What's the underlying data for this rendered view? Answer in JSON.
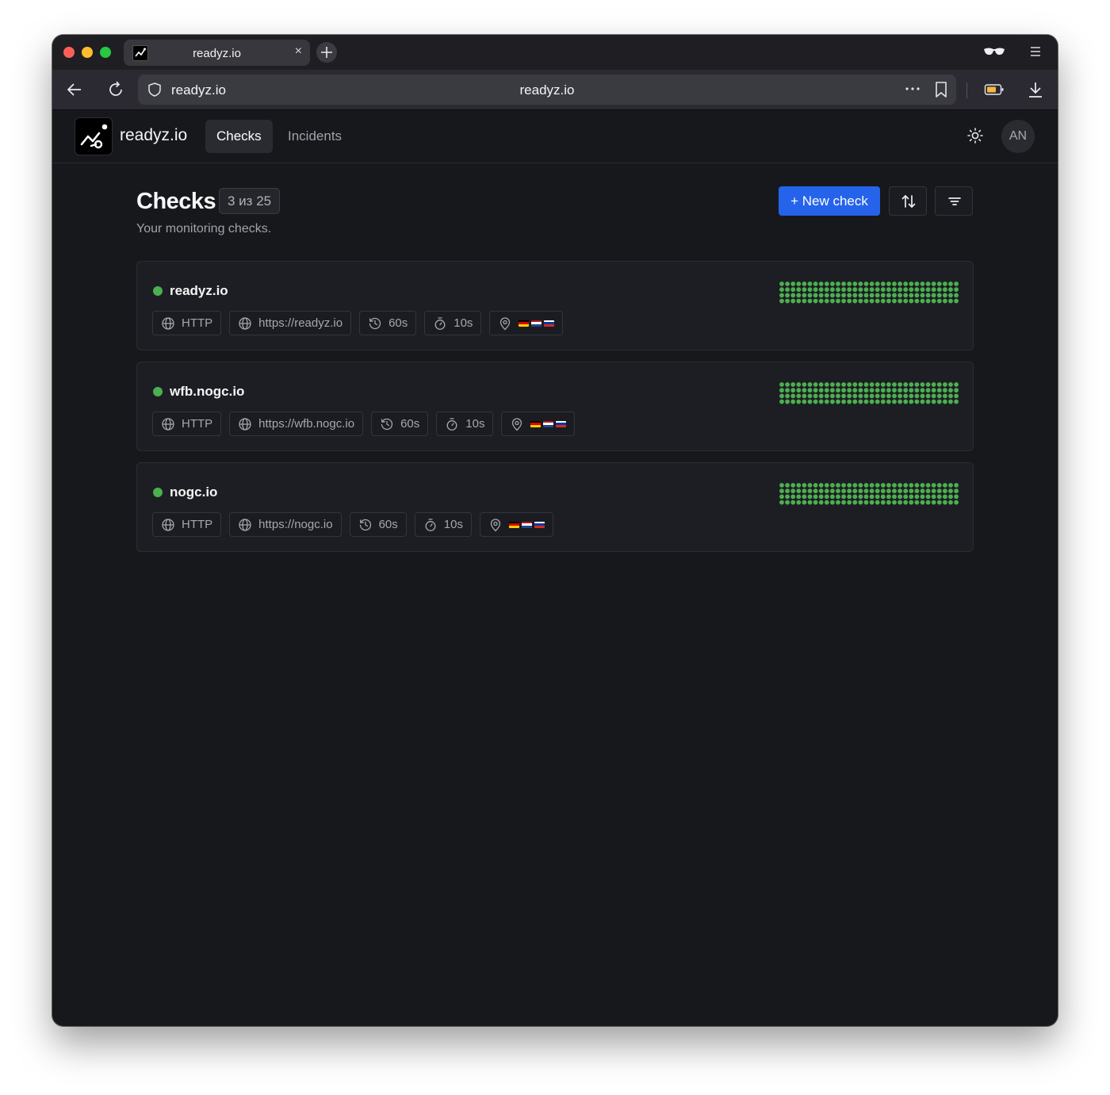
{
  "browser": {
    "tab_title": "readyz.io",
    "tab_close": "×",
    "url_host": "readyz.io",
    "url_center": "readyz.io"
  },
  "app": {
    "brand": "readyz.io",
    "nav": [
      {
        "label": "Checks",
        "active": true
      },
      {
        "label": "Incidents",
        "active": false
      }
    ],
    "avatar_initials": "AN"
  },
  "page": {
    "title": "Checks",
    "count": "3 из 25",
    "subtitle": "Your monitoring checks.",
    "new_button": "+ New check"
  },
  "colors": {
    "accent": "#2563eb",
    "status_up": "#4caf50",
    "uptime_dot": "#4caf50"
  },
  "checks": [
    {
      "name": "readyz.io",
      "status": "up",
      "type": "HTTP",
      "url": "https://readyz.io",
      "interval": "60s",
      "timeout": "10s",
      "regions": [
        "de",
        "nl",
        "ru"
      ]
    },
    {
      "name": "wfb.nogc.io",
      "status": "up",
      "type": "HTTP",
      "url": "https://wfb.nogc.io",
      "interval": "60s",
      "timeout": "10s",
      "regions": [
        "de",
        "nl",
        "ru"
      ]
    },
    {
      "name": "nogc.io",
      "status": "up",
      "type": "HTTP",
      "url": "https://nogc.io",
      "interval": "60s",
      "timeout": "10s",
      "regions": [
        "de",
        "nl",
        "ru"
      ]
    }
  ],
  "uptime_grid": {
    "columns": 32,
    "rows": 4,
    "state": "all-up"
  },
  "icons": {
    "back": "arrow-left-icon",
    "reload": "reload-icon",
    "shield": "shield-icon",
    "more": "more-icon",
    "bookmark": "bookmark-icon",
    "battery": "battery-icon",
    "download": "download-icon",
    "reader": "glasses-icon",
    "menu": "menu-icon",
    "theme": "sun-icon",
    "sort": "sort-icon",
    "filter": "filter-icon",
    "type": "globe-icon",
    "url": "globe-icon",
    "interval": "history-icon",
    "timeout": "timer-icon",
    "regions": "map-pin-icon"
  }
}
